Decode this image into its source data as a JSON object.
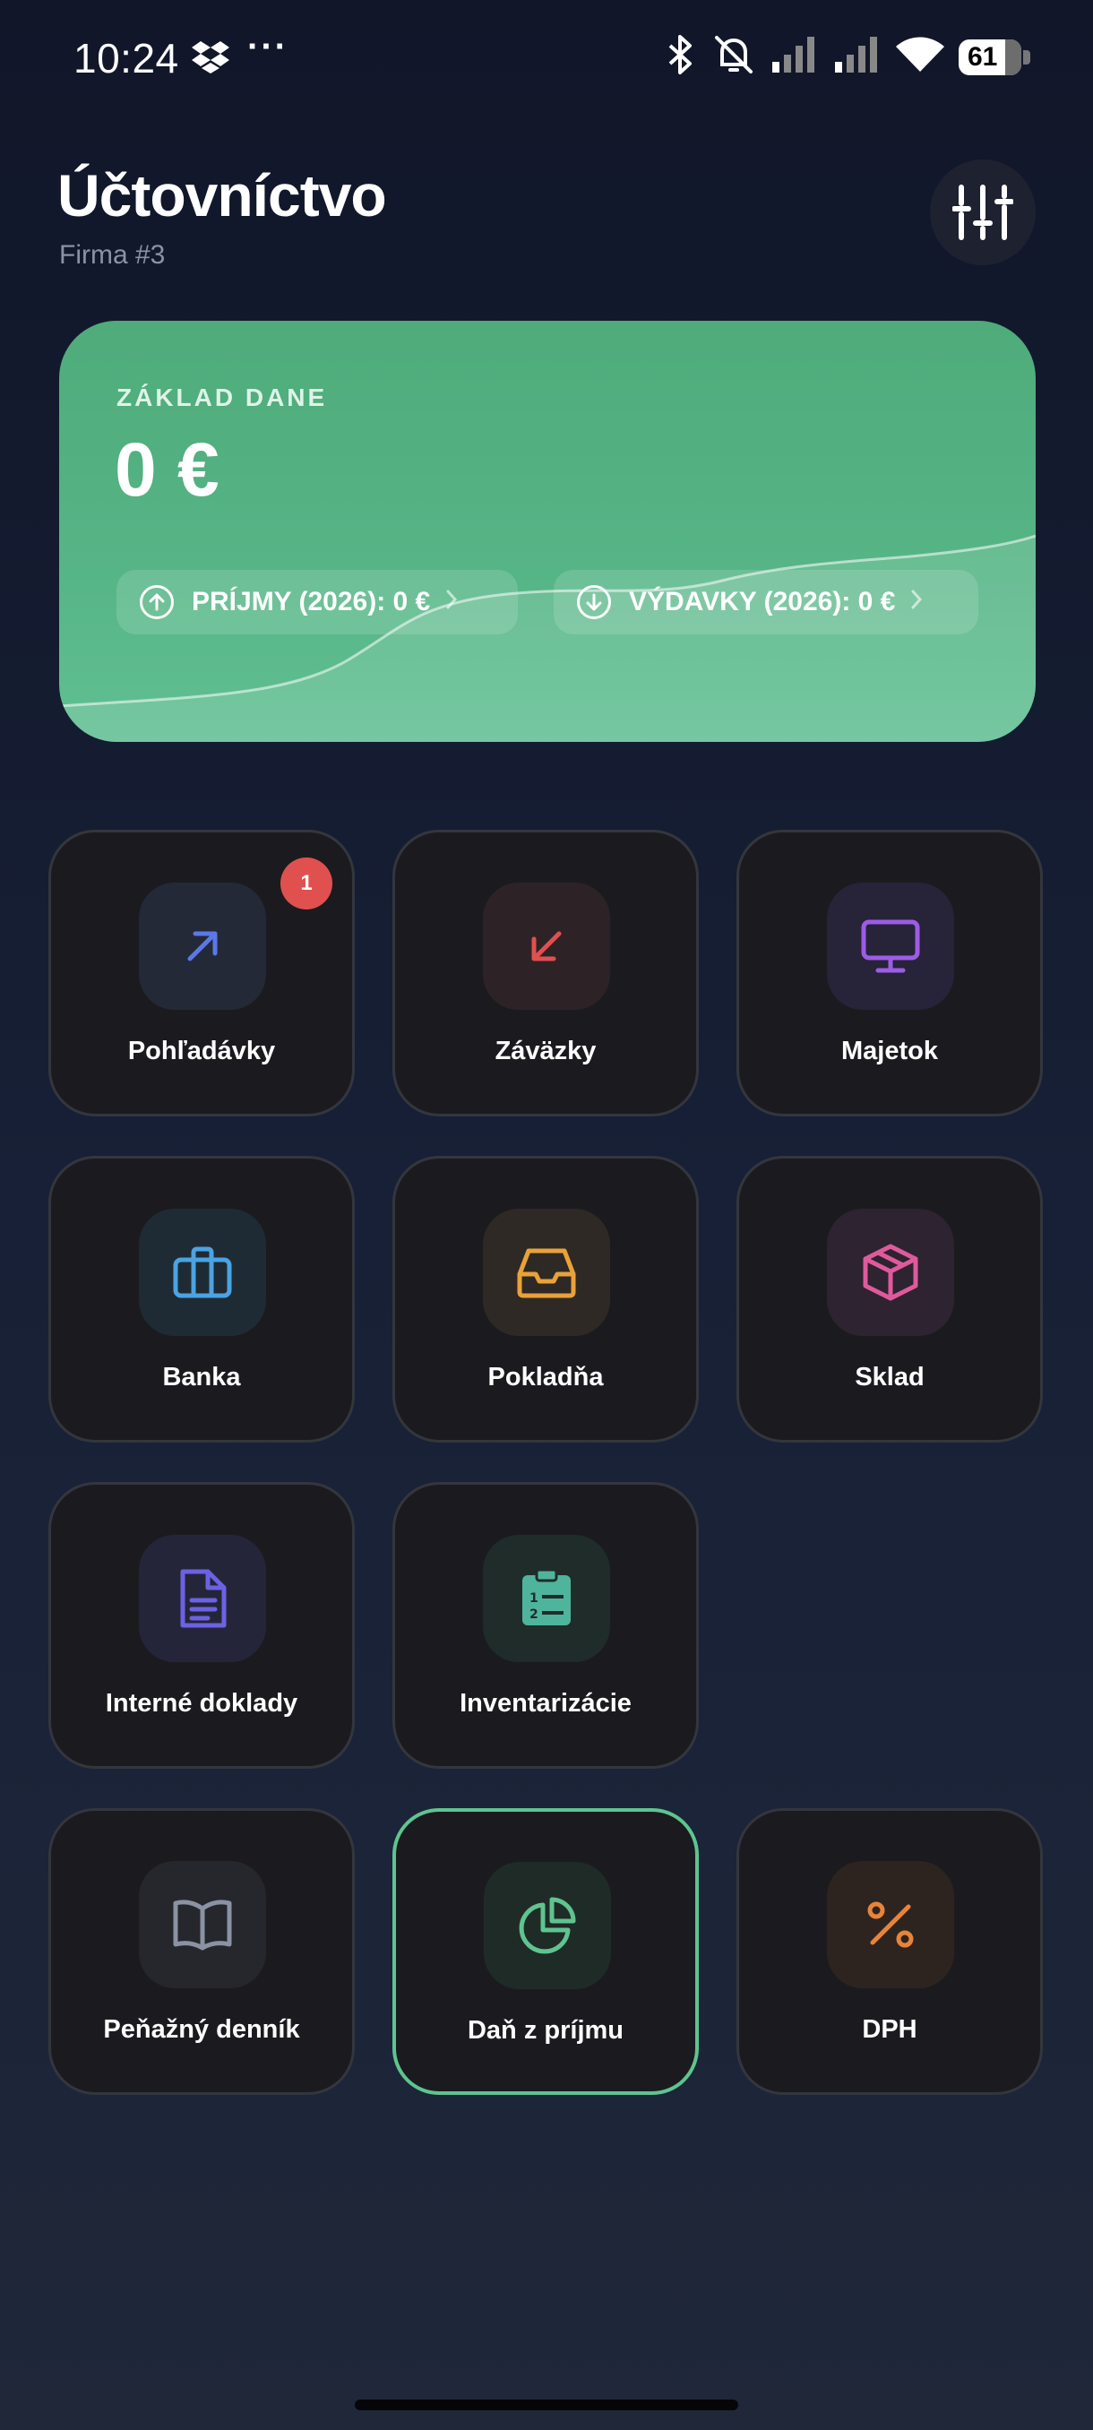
{
  "status": {
    "time": "10:24",
    "more": "···",
    "battery": "61"
  },
  "header": {
    "title": "Účtovníctvo",
    "subtitle": "Firma #3"
  },
  "summary": {
    "label": "ZÁKLAD DANE",
    "amount": "0 €",
    "income_label": "PRÍJMY (2026): 0 €",
    "expense_label": "VÝDAVKY (2026): 0 €"
  },
  "tiles": [
    {
      "label": "Pohľadávky",
      "badge": "1",
      "icon": "arrow-up-right-icon",
      "color": "#5b78e6"
    },
    {
      "label": "Záväzky",
      "icon": "arrow-down-left-icon",
      "color": "#e0504f"
    },
    {
      "label": "Majetok",
      "icon": "monitor-icon",
      "color": "#9c5ce6"
    },
    {
      "label": "Banka",
      "icon": "briefcase-icon",
      "color": "#4ba3e2"
    },
    {
      "label": "Pokladňa",
      "icon": "inbox-tray-icon",
      "color": "#e9a23a"
    },
    {
      "label": "Sklad",
      "icon": "package-box-icon",
      "color": "#df5a9c"
    },
    {
      "label": "Interné doklady",
      "icon": "document-icon",
      "color": "#6b62e3"
    },
    {
      "label": "Inventarizácie",
      "icon": "clipboard-list-icon",
      "color": "#4fb49c"
    },
    {
      "label": "Peňažný denník",
      "icon": "open-book-icon",
      "color": "#8a92a3"
    },
    {
      "label": "Daň z príjmu",
      "icon": "pie-chart-icon",
      "color": "#5fc48f",
      "selected": true
    },
    {
      "label": "DPH",
      "icon": "percent-icon",
      "color": "#e8843a"
    }
  ]
}
